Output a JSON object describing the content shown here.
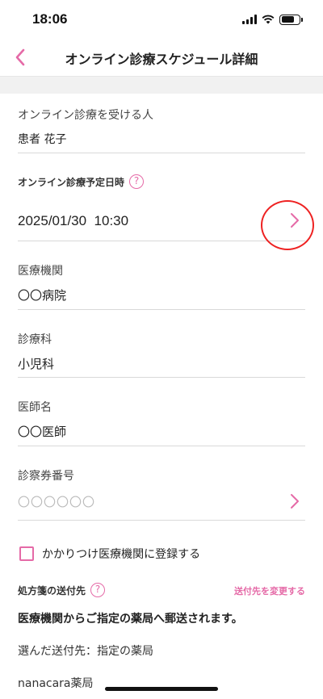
{
  "status": {
    "time": "18:06"
  },
  "nav": {
    "title": "オンライン診療スケジュール詳細"
  },
  "patient": {
    "label": "オンライン診療を受ける人",
    "value": "患者 花子"
  },
  "schedule": {
    "label": "オンライン診療予定日時",
    "help": "?",
    "value": "2025/01/30  10:30"
  },
  "hospital": {
    "label": "医療機関",
    "value": "〇〇病院"
  },
  "department": {
    "label": "診療科",
    "value": "小児科"
  },
  "doctor": {
    "label": "医師名",
    "value": "〇〇医師"
  },
  "card_number": {
    "label": "診察券番号",
    "placeholder": "〇〇〇〇〇〇"
  },
  "family_clinic": {
    "label": "かかりつけ医療機関に登録する",
    "checked": false
  },
  "prescription": {
    "label": "処方箋の送付先",
    "help": "?",
    "change_label": "送付先を変更する",
    "notice": "医療機関からご指定の薬局へ郵送されます。",
    "selected_label": "選んだ送付先：指定の薬局",
    "pharmacy_name": "nanacara薬局"
  },
  "colors": {
    "accent": "#e56aa7",
    "highlight_circle": "#e22222"
  }
}
